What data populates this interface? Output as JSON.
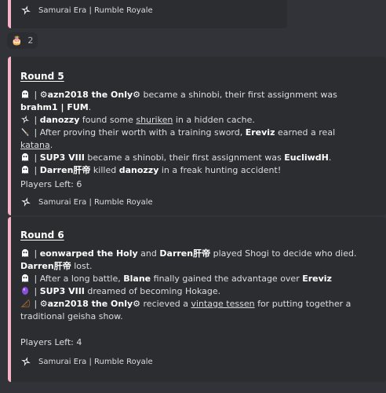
{
  "footer_text": "Samurai Era | Rumble Royale",
  "reaction": {
    "emoji": "🎂",
    "count": "2"
  },
  "accent_color": "#f8b3c6",
  "rounds": [
    {
      "title": "Round 5",
      "players_left": "Players Left: 6",
      "lines": [
        {
          "icon": "ghost-icon",
          "segments": [
            {
              "t": " | ",
              "s": "n"
            },
            {
              "t": "⚙azn2018 the Only⚙",
              "s": "b"
            },
            {
              "t": " became a shinobi, their first assignment was ",
              "s": "n"
            },
            {
              "t": "brahm1 | FUM",
              "s": "b"
            },
            {
              "t": ".",
              "s": "n"
            }
          ]
        },
        {
          "icon": "shuriken-icon",
          "segments": [
            {
              "t": " | ",
              "s": "n"
            },
            {
              "t": "danozzy",
              "s": "b"
            },
            {
              "t": " found some ",
              "s": "n"
            },
            {
              "t": "shuriken",
              "s": "u"
            },
            {
              "t": " in a hidden cache.",
              "s": "n"
            }
          ]
        },
        {
          "icon": "sword-icon",
          "segments": [
            {
              "t": " | After proving their worth with a training sword, ",
              "s": "n"
            },
            {
              "t": "Ereviz",
              "s": "b"
            },
            {
              "t": " earned a real ",
              "s": "n"
            },
            {
              "t": "katana",
              "s": "u"
            },
            {
              "t": ".",
              "s": "n"
            }
          ]
        },
        {
          "icon": "ghost-icon",
          "segments": [
            {
              "t": " | ",
              "s": "n"
            },
            {
              "t": "SUP3 VIII",
              "s": "b"
            },
            {
              "t": " became a shinobi, their first assignment was ",
              "s": "n"
            },
            {
              "t": "EucliwdH",
              "s": "b"
            },
            {
              "t": ".",
              "s": "n"
            }
          ]
        },
        {
          "icon": "ghost-icon",
          "segments": [
            {
              "t": " | ",
              "s": "n"
            },
            {
              "t": "Darren肝帝",
              "s": "b"
            },
            {
              "t": " killed ",
              "s": "n"
            },
            {
              "t": "danozzy",
              "s": "b"
            },
            {
              "t": " in a freak hunting accident!",
              "s": "n"
            }
          ]
        }
      ]
    },
    {
      "title": "Round 6",
      "players_left": "Players Left: 4",
      "lines": [
        {
          "icon": "ghost-icon",
          "segments": [
            {
              "t": " | ",
              "s": "n"
            },
            {
              "t": "eonwarped the Holy",
              "s": "b"
            },
            {
              "t": " and ",
              "s": "n"
            },
            {
              "t": "Darren肝帝",
              "s": "b"
            },
            {
              "t": " played Shogi to decide who died. ",
              "s": "n"
            },
            {
              "t": "Darren肝帝",
              "s": "b"
            },
            {
              "t": " lost.",
              "s": "n"
            }
          ]
        },
        {
          "icon": "ghost-icon",
          "segments": [
            {
              "t": " | After a long battle, ",
              "s": "n"
            },
            {
              "t": "Blane",
              "s": "b"
            },
            {
              "t": " finally gained the advantage over ",
              "s": "n"
            },
            {
              "t": "Ereviz",
              "s": "b"
            }
          ]
        },
        {
          "icon": "purple-orb-icon",
          "segments": [
            {
              "t": " | ",
              "s": "n"
            },
            {
              "t": "SUP3 VIII",
              "s": "b"
            },
            {
              "t": " dreamed of becoming Hokage.",
              "s": "n"
            }
          ]
        },
        {
          "icon": "tessen-icon",
          "segments": [
            {
              "t": " | ",
              "s": "n"
            },
            {
              "t": "⚙azn2018 the Only⚙",
              "s": "b"
            },
            {
              "t": " recieved a ",
              "s": "n"
            },
            {
              "t": "vintage tessen",
              "s": "u"
            },
            {
              "t": " for putting together a traditional geisha show.",
              "s": "n"
            }
          ]
        }
      ]
    }
  ]
}
